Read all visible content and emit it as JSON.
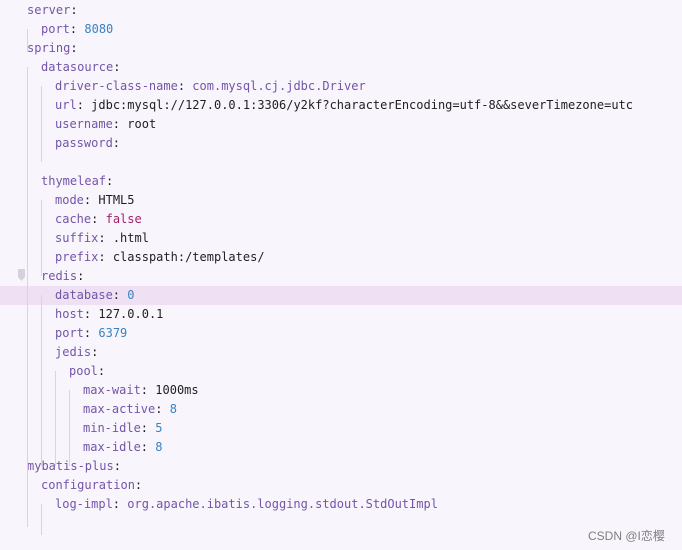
{
  "editor": {
    "lines": [
      {
        "key": "server",
        "value": "",
        "kind": ""
      },
      {
        "key": "port",
        "value": "8080",
        "kind": "num"
      },
      {
        "key": "spring",
        "value": "",
        "kind": ""
      },
      {
        "key": "datasource",
        "value": "",
        "kind": ""
      },
      {
        "key": "driver-class-name",
        "value": "com.mysql.cj.jdbc.Driver",
        "kind": "cls"
      },
      {
        "key": "url",
        "value": "jdbc:mysql://127.0.0.1:3306/y2kf?characterEncoding=utf-8&&severTimezone=utc",
        "kind": "str"
      },
      {
        "key": "username",
        "value": "root",
        "kind": "str"
      },
      {
        "key": "password",
        "value": "",
        "kind": ""
      },
      {
        "key": "",
        "value": "",
        "kind": "blank"
      },
      {
        "key": "thymeleaf",
        "value": "",
        "kind": ""
      },
      {
        "key": "mode",
        "value": "HTML5",
        "kind": "str"
      },
      {
        "key": "cache",
        "value": "false",
        "kind": "bool"
      },
      {
        "key": "suffix",
        "value": ".html",
        "kind": "str"
      },
      {
        "key": "prefix",
        "value": "classpath:/templates/",
        "kind": "str"
      },
      {
        "key": "redis",
        "value": "",
        "kind": ""
      },
      {
        "key": "database",
        "value": "0",
        "kind": "num"
      },
      {
        "key": "host",
        "value": "127.0.0.1",
        "kind": "str"
      },
      {
        "key": "port",
        "value": "6379",
        "kind": "num"
      },
      {
        "key": "jedis",
        "value": "",
        "kind": ""
      },
      {
        "key": "pool",
        "value": "",
        "kind": ""
      },
      {
        "key": "max-wait",
        "value": "1000ms",
        "kind": "str"
      },
      {
        "key": "max-active",
        "value": "8",
        "kind": "num"
      },
      {
        "key": "min-idle",
        "value": "5",
        "kind": "num"
      },
      {
        "key": "max-idle",
        "value": "8",
        "kind": "num"
      },
      {
        "key": "mybatis-plus",
        "value": "",
        "kind": ""
      },
      {
        "key": "configuration",
        "value": "",
        "kind": ""
      },
      {
        "key": "log-impl",
        "value": "org.apache.ibatis.logging.stdout.StdOutImpl",
        "kind": "cls"
      },
      {
        "key": "",
        "value": "",
        "kind": "blank"
      }
    ],
    "current_line": 15
  },
  "watermark": "CSDN @I恋樱",
  "colors": {
    "background": "#f8f5fc",
    "current_line": "#efe1f3",
    "key": "#7355a8",
    "number": "#3a82c0",
    "boolean": "#a0226b",
    "plain_value": "#1f1f1f",
    "class_value": "#7355a8",
    "indent_guide": "#d9d3e2"
  },
  "icons": [
    "code-fold-marker-icon"
  ]
}
